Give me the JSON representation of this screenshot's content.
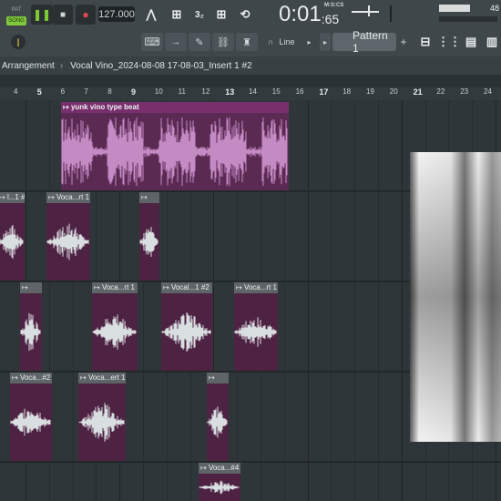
{
  "toolbar": {
    "pat_label": "PAT",
    "song_label": "SONG",
    "tempo": "127.000",
    "time_main": "0:01",
    "time_sub": ":65",
    "time_unit": "M:S:CS",
    "volume_value": "48",
    "line_label": "Line",
    "pattern_label": "Pattern 1",
    "pattern_add": "+",
    "icons": [
      "play-icon",
      "stop-icon",
      "record-icon",
      "metronome-icon",
      "wait-icon",
      "countdown-icon",
      "step-edit-icon",
      "loop-record-icon",
      "typing-keyboard-icon",
      "arrow-icon",
      "paint-icon",
      "link-icon",
      "stamp-icon",
      "magnet-icon",
      "mixer-icon",
      "channel-rack-icon",
      "piano-roll-icon",
      "browser-icon"
    ]
  },
  "breadcrumb": {
    "root": "Arrangement",
    "sep": "›",
    "path": "Vocal Vino_2024-08-08 17-08-03_Insert 1 #2"
  },
  "ruler": {
    "labels": [
      "4",
      "5",
      "6",
      "7",
      "8",
      "9",
      "10",
      "11",
      "12",
      "13",
      "14",
      "15",
      "16",
      "17",
      "18",
      "19",
      "20",
      "21",
      "22",
      "23",
      "24"
    ]
  },
  "clips": {
    "beat": "yunk vino type beat",
    "t2a": "l...1 #2",
    "t2b": "Voca...rt 1",
    "t2c": "",
    "t3a": "",
    "t3b": "Voca...rt 1",
    "t3c": "Vocal...1 #2",
    "t3d": "Voca...rt 1",
    "t4a": "Voca...#2",
    "t4b": "Voca...ert 1",
    "t4c": "",
    "t5a": "Voca...#4"
  },
  "colors": {
    "accent": "#7ec93a",
    "clip_bg": "#4e2243",
    "beat_clip": "#7a2f6d",
    "wave_beat": "#c48ac4",
    "wave_vocal": "#d9dee0"
  }
}
